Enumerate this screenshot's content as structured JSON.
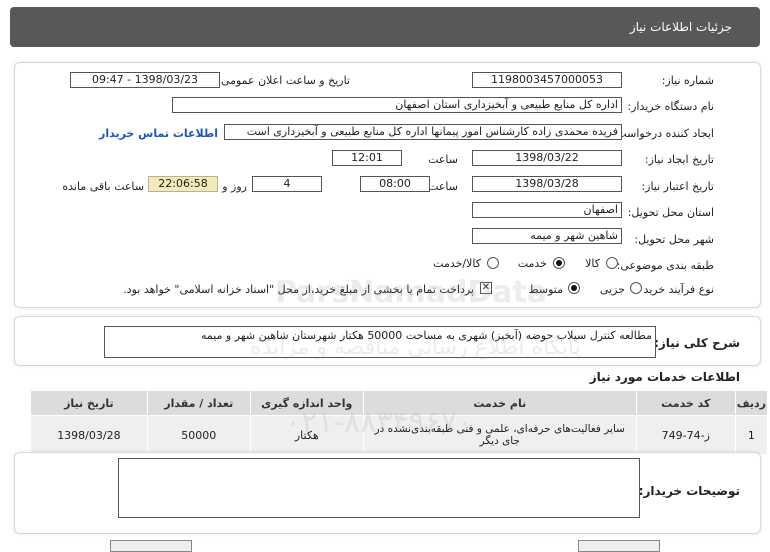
{
  "header": {
    "title": "جزئیات اطلاعات نیاز"
  },
  "form": {
    "need_number_label": "شماره نیاز:",
    "need_number": "1198003457000053",
    "announce_label": "تاریخ و ساعت اعلان عمومی:",
    "announce_value": "1398/03/23 - 09:47",
    "buyer_label": "نام دستگاه خریدار:",
    "buyer_value": "اداره کل منابع طبیعی و آبخیزداری استان اصفهان",
    "creator_label": "ایجاد کننده درخواست:",
    "creator_value": "فریده محمدی زاده کارشناس امور پیمانها اداره کل منابع طبیعی و آبخیزداری است",
    "contact_link": "اطلاعات تماس خریدار",
    "created_label": "تاریخ ایجاد نیاز:",
    "created_date": "1398/03/22",
    "time_label": "ساعت",
    "created_time": "12:01",
    "valid_label": "تاریخ اعتبار نیاز:",
    "valid_date": "1398/03/28",
    "valid_time": "08:00",
    "days_value": "4",
    "days_label": "روز و",
    "remaining_value": "22:06:58",
    "remaining_label": "ساعت باقی مانده",
    "province_label": "استان محل تحویل:",
    "province_value": "اصفهان",
    "city_label": "شهر محل تحویل:",
    "city_value": "شاهین شهر و میمه",
    "category_label": "طبقه بندی موضوعی:",
    "category_options": [
      "کالا",
      "خدمت",
      "کالا/خدمت"
    ],
    "process_label": "نوع فرآیند خرید :",
    "process_options": [
      "جزیی",
      "متوسط"
    ],
    "payment_note": "پرداخت تمام یا بخشی از مبلغ خرید،از محل \"اسناد خزانه اسلامی\" خواهد بود."
  },
  "description": {
    "label": "شرح کلی نیاز:",
    "value": "مطالعه کنترل سیلاب حوضه (آبخیز) شهری به مساحت 50000 هکتار شهرستان شاهین شهر و میمه"
  },
  "services": {
    "title": "اطلاعات خدمات مورد نیاز",
    "headers": [
      "ردیف",
      "کد خدمت",
      "نام خدمت",
      "واحد اندازه گیری",
      "تعداد / مقدار",
      "تاریخ نیاز"
    ],
    "rows": [
      [
        "1",
        "ز-74-749",
        "سایر فعالیت‌های حرفه‌ای، علمی و فنی طبقه‌بندی‌نشده در جای دیگر",
        "هکتار",
        "50000",
        "1398/03/28"
      ]
    ]
  },
  "buyer_notes": {
    "label": "توضیحات خریدار:",
    "value": ""
  },
  "watermark": {
    "line1": "ParsNamadData",
    "line2": "پایگاه اطلاع رسانی مناقصه و مزایده",
    "line3": "۰۲۱-۸۸۳۴۹۶۷۰"
  }
}
